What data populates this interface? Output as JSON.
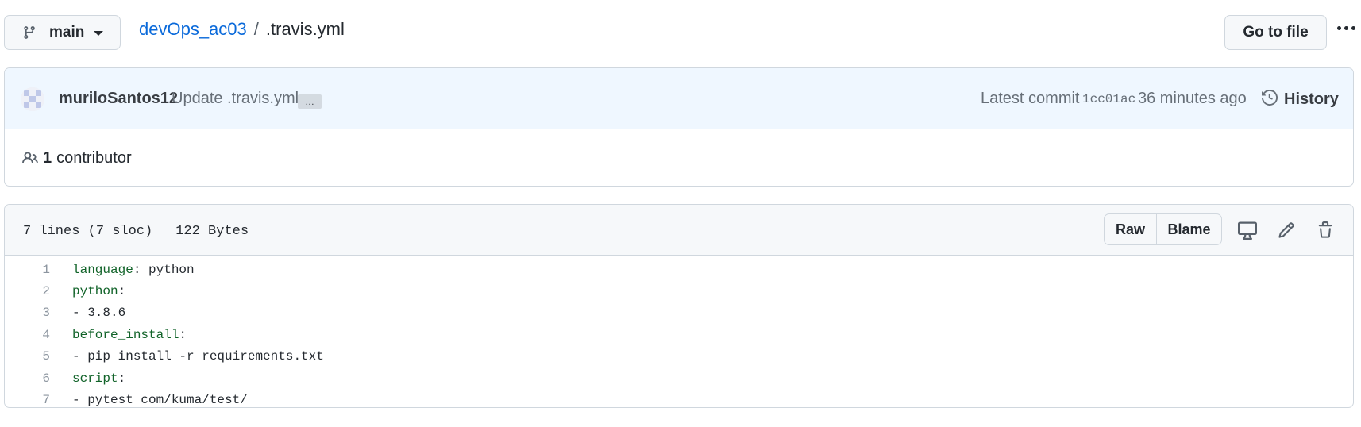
{
  "topbar": {
    "branch": "main",
    "repo": "devOps_ac03",
    "separator": "/",
    "file": ".travis.yml",
    "goto_label": "Go to file"
  },
  "commit": {
    "author": "muriloSantos12",
    "message": "Update .travis.yml",
    "ellipsis": "…",
    "latest_label": "Latest commit",
    "sha": "1cc01ac",
    "time": "36 minutes ago",
    "history_label": "History"
  },
  "contributors": {
    "count": "1",
    "label": "contributor"
  },
  "file": {
    "lines_info": "7 lines (7 sloc)",
    "size": "122 Bytes",
    "raw_label": "Raw",
    "blame_label": "Blame"
  },
  "code_lines": [
    {
      "num": "1",
      "key": "language",
      "rest": ": python"
    },
    {
      "num": "2",
      "key": "python",
      "rest": ":"
    },
    {
      "num": "3",
      "key": "",
      "rest": "- 3.8.6"
    },
    {
      "num": "4",
      "key": "before_install",
      "rest": ":"
    },
    {
      "num": "5",
      "key": "",
      "rest": "- pip install -r requirements.txt"
    },
    {
      "num": "6",
      "key": "script",
      "rest": ":"
    },
    {
      "num": "7",
      "key": "",
      "rest": "- pytest com/kuma/test/"
    }
  ],
  "colors": {
    "link": "#0969da",
    "yaml_key": "#116329",
    "commit_bg": "#eef7ff"
  },
  "icons": [
    "git-branch-icon",
    "caret-down-icon",
    "kebab-horizontal-icon",
    "history-icon",
    "people-icon",
    "desktop-icon",
    "pencil-icon",
    "trash-icon"
  ]
}
